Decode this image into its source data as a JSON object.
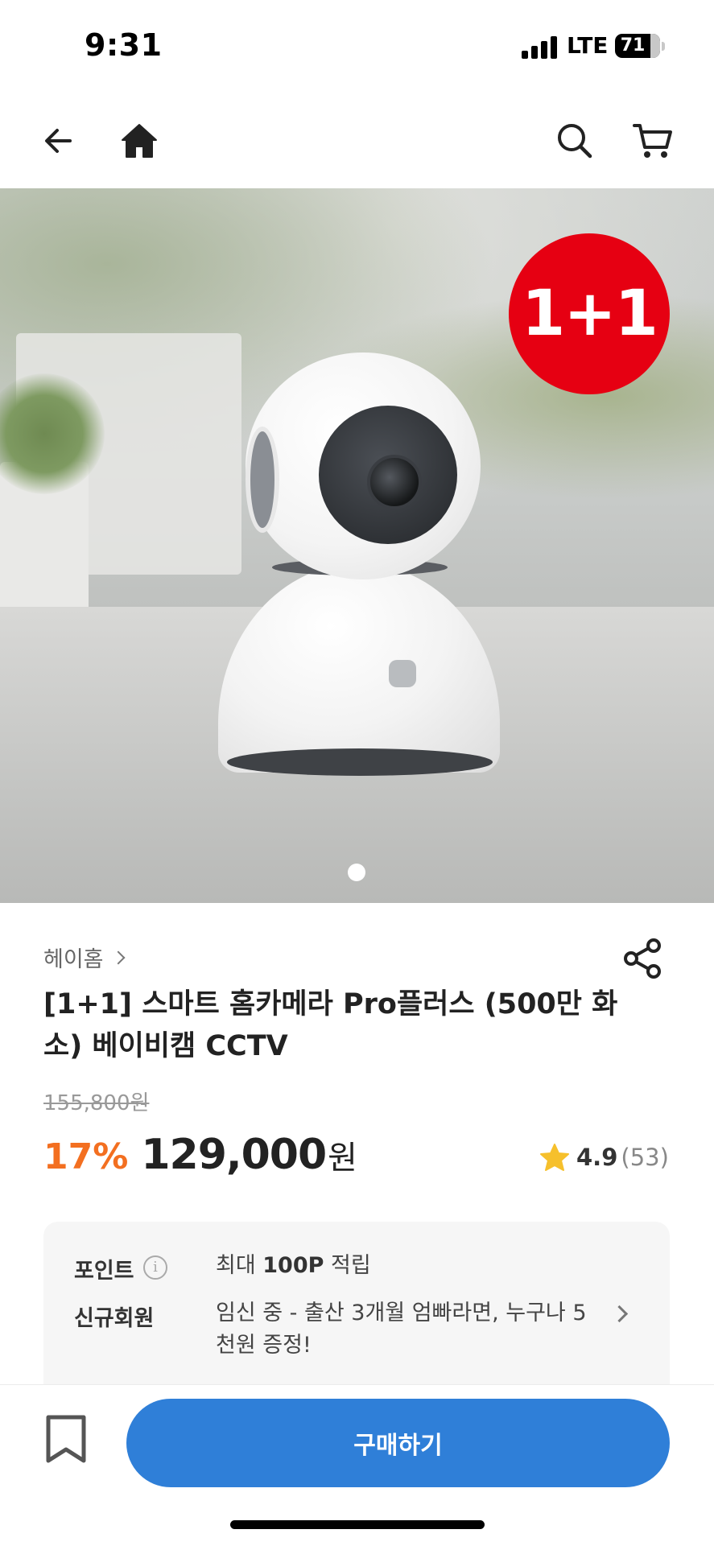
{
  "status_bar": {
    "time": "9:31",
    "network": "LTE",
    "battery": "71"
  },
  "nav": {
    "back_icon": "arrow-left-icon",
    "home_icon": "home-icon",
    "search_icon": "search-icon",
    "cart_icon": "cart-icon"
  },
  "hero": {
    "badge": "1+1",
    "carousel_index": 1,
    "carousel_total": 1
  },
  "product": {
    "brand": "헤이홈",
    "title": "[1+1] 스마트 홈카메라 Pro플러스 (500만 화소) 베이비캠 CCTV",
    "original_price": "155,800원",
    "discount": "17%",
    "price": "129,000",
    "currency": "원",
    "rating": "4.9",
    "review_count": "(53)"
  },
  "benefits": {
    "point_label": "포인트",
    "point_info_icon": "info-icon",
    "point_value_prefix": "최대 ",
    "point_value_bold": "100P",
    "point_value_suffix": " 적립",
    "member_label": "신규회원",
    "member_value": "임신 중 - 출산 3개월 엄빠라면, 누구나 5천원 증정!"
  },
  "bottom": {
    "bookmark_icon": "bookmark-icon",
    "buy_label": "구매하기"
  },
  "colors": {
    "accent_blue": "#2f7fd8",
    "discount_orange": "#f36f20",
    "badge_red": "#e60012",
    "star_yellow": "#f6c02c"
  }
}
